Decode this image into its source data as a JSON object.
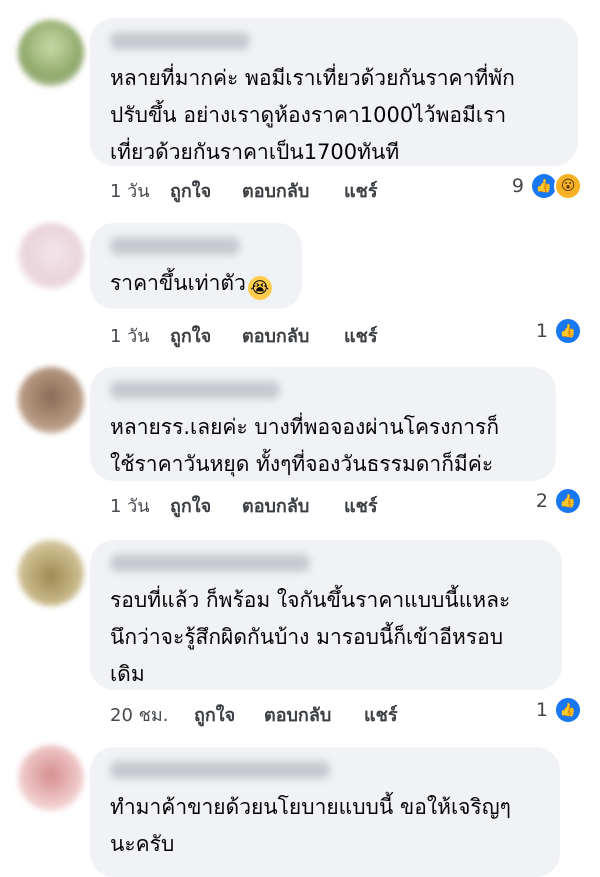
{
  "comments": [
    {
      "text": "หลายที่มากค่ะ พอมีเราเที่ยวด้วยกันราคาที่พัก\nปรับขึ้น อย่างเราดูห้องราคา1000ไว้พอมีเรา\nเที่ยวด้วยกันราคาเป็น1700ทันที",
      "time": "1 วัน",
      "like": "ถูกใจ",
      "reply": "ตอบกลับ",
      "share": "แชร์",
      "reaction_count": "9",
      "reactions": [
        "like-icon",
        "wow-icon"
      ]
    },
    {
      "text": "ราคาขึ้นเท่าตัว",
      "emoji": "😭",
      "time": "1 วัน",
      "like": "ถูกใจ",
      "reply": "ตอบกลับ",
      "share": "แชร์",
      "reaction_count": "1",
      "reactions": [
        "like-icon"
      ]
    },
    {
      "text": "หลายรร.เลยค่ะ บางที่พอจองผ่านโครงการก็\nใช้ราคาวันหยุด ทั้งๆที่จองวันธรรมดาก็มีค่ะ",
      "time": "1 วัน",
      "like": "ถูกใจ",
      "reply": "ตอบกลับ",
      "share": "แชร์",
      "reaction_count": "2",
      "reactions": [
        "like-icon"
      ]
    },
    {
      "text": "รอบที่แล้ว ก็พร้อม ใจกันขึ้นราคาแบบนี้แหละ\nนึกว่าจะรู้สึกผิดกันบ้าง มารอบนี้ก็เข้าอีหรอบ\nเดิม",
      "time": "20 ชม.",
      "like": "ถูกใจ",
      "reply": "ตอบกลับ",
      "share": "แชร์",
      "reaction_count": "1",
      "reactions": [
        "like-icon"
      ]
    },
    {
      "text": "ทำมาค้าขายด้วยนโยบายแบบนี้ ขอให้เจริญๆ\nนะครับ"
    }
  ],
  "colors": {
    "bubble": "#f0f2f5",
    "like_blue": "#1877f2",
    "wow_yellow": "#f7b125"
  }
}
